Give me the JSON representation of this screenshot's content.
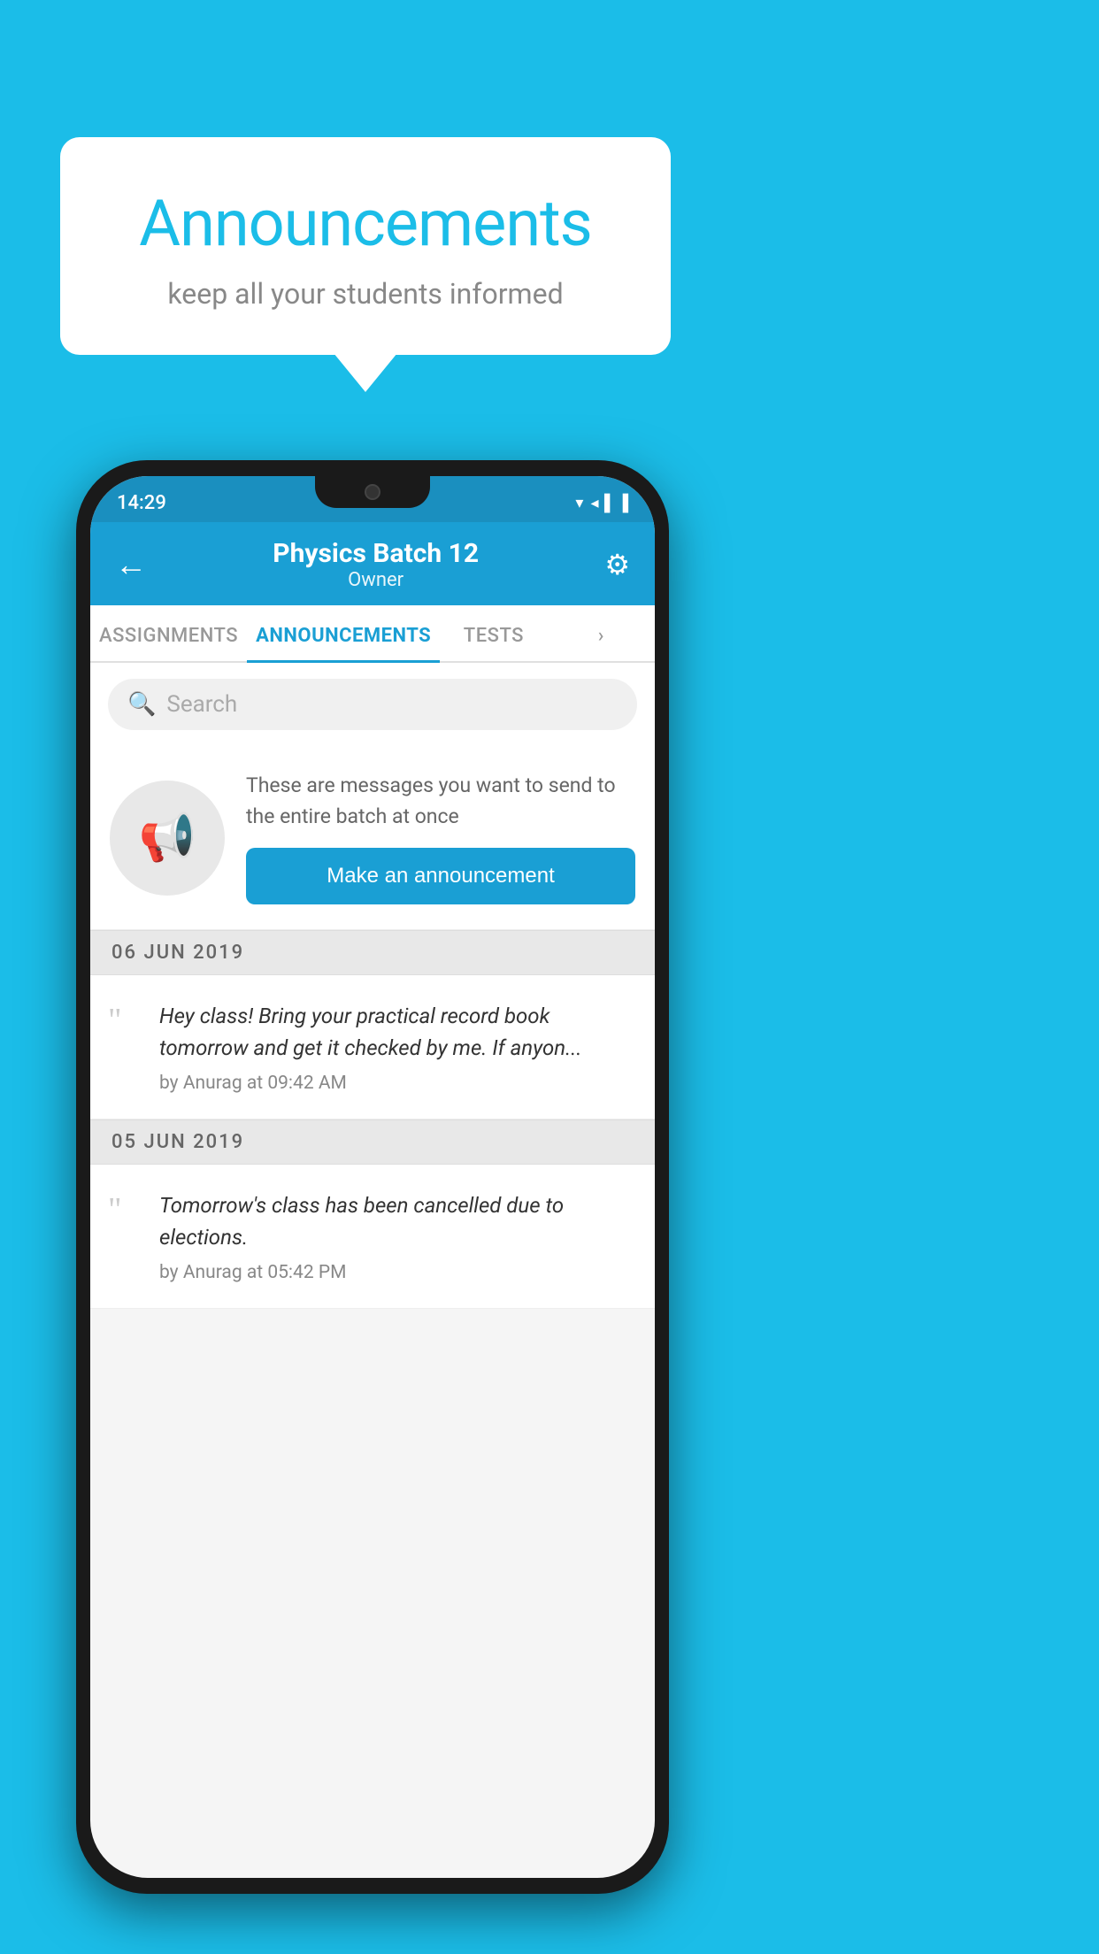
{
  "background_color": "#1BBDE8",
  "bubble": {
    "title": "Announcements",
    "subtitle": "keep all your students informed"
  },
  "phone": {
    "status_bar": {
      "time": "14:29",
      "icons": "▾◂▐"
    },
    "header": {
      "title": "Physics Batch 12",
      "subtitle": "Owner",
      "back_label": "←",
      "gear_label": "⚙"
    },
    "tabs": [
      {
        "label": "ASSIGNMENTS",
        "active": false
      },
      {
        "label": "ANNOUNCEMENTS",
        "active": true
      },
      {
        "label": "TESTS",
        "active": false
      },
      {
        "label": "•••",
        "active": false
      }
    ],
    "search": {
      "placeholder": "Search"
    },
    "announcement_prompt": {
      "description": "These are messages you want to send to the entire batch at once",
      "button_label": "Make an announcement"
    },
    "announcements": [
      {
        "date": "06  JUN  2019",
        "text": "Hey class! Bring your practical record book tomorrow and get it checked by me. If anyon...",
        "meta": "by Anurag at 09:42 AM"
      },
      {
        "date": "05  JUN  2019",
        "text": "Tomorrow's class has been cancelled due to elections.",
        "meta": "by Anurag at 05:42 PM"
      }
    ]
  }
}
